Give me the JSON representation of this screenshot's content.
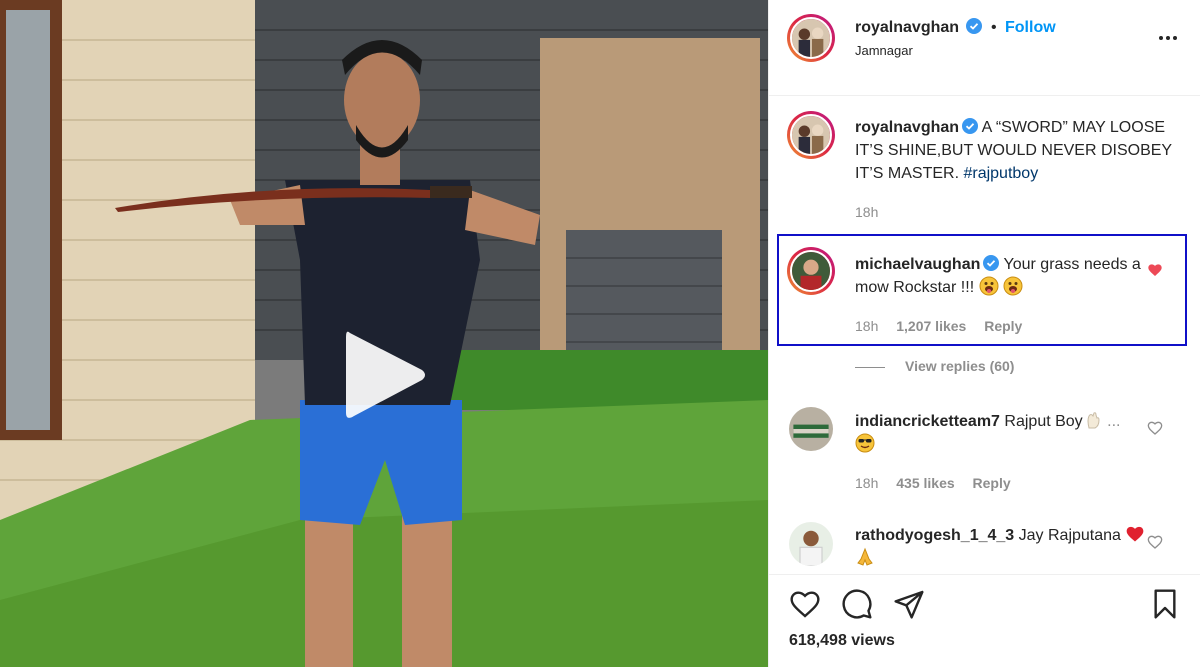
{
  "post": {
    "username": "royalnavghan",
    "follow_label": "Follow",
    "separator": "•",
    "location": "Jamnagar",
    "more_icon": "more-horizontal-icon"
  },
  "caption": {
    "username": "royalnavghan",
    "text": "A “SWORD” MAY LOOSE IT’S SHINE,BUT WOULD NEVER DISOBEY IT’S MASTER.",
    "hashtag": "#rajputboy",
    "time": "18h"
  },
  "comments": [
    {
      "username": "michaelvaughan",
      "text": "Your grass needs a mow Rockstar !!!",
      "time": "18h",
      "likes": "1,207 likes",
      "reply": "Reply",
      "liked": true
    },
    {
      "username": "indiancricketteam7",
      "text": "Rajput Boy",
      "time": "18h",
      "likes": "435 likes",
      "reply": "Reply",
      "liked": false
    },
    {
      "username": "rathodyogesh_1_4_3",
      "text": "Jay Rajputana",
      "liked": false
    }
  ],
  "view_replies": "View replies (60)",
  "views": "618,498 views",
  "colors": {
    "accent": "#0095f6",
    "verified": "#3897f0",
    "liked_heart": "#ed4956",
    "highlight_border": "#1010c8",
    "hashtag": "#00376b"
  },
  "icons": {
    "like": "heart-icon",
    "comment": "comment-icon",
    "share": "paper-plane-icon",
    "save": "bookmark-icon",
    "play": "play-icon"
  }
}
